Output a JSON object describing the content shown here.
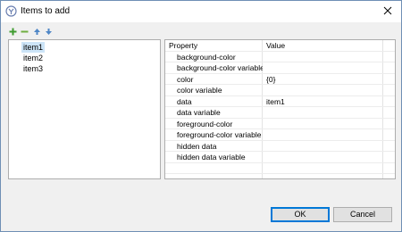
{
  "window": {
    "title": "Items to add"
  },
  "toolbar": {
    "add_icon": "plus-icon",
    "remove_icon": "minus-icon",
    "up_icon": "arrow-up-icon",
    "down_icon": "arrow-down-icon",
    "colors": {
      "add": "#3e9b2f",
      "remove": "#6fae3f",
      "move": "#4f86c6"
    }
  },
  "items": [
    "item1",
    "item2",
    "item3"
  ],
  "selected_item": "item1",
  "properties": {
    "header": {
      "property": "Property",
      "value": "Value"
    },
    "rows": [
      {
        "name": "background-color",
        "value": ""
      },
      {
        "name": "background-color variable",
        "value": ""
      },
      {
        "name": "color",
        "value": "{0}"
      },
      {
        "name": "color variable",
        "value": ""
      },
      {
        "name": "data",
        "value": "item1"
      },
      {
        "name": "data variable",
        "value": ""
      },
      {
        "name": "foreground-color",
        "value": ""
      },
      {
        "name": "foreground-color variable",
        "value": ""
      },
      {
        "name": "hidden data",
        "value": ""
      },
      {
        "name": "hidden data variable",
        "value": ""
      }
    ]
  },
  "buttons": {
    "ok": "OK",
    "cancel": "Cancel"
  }
}
